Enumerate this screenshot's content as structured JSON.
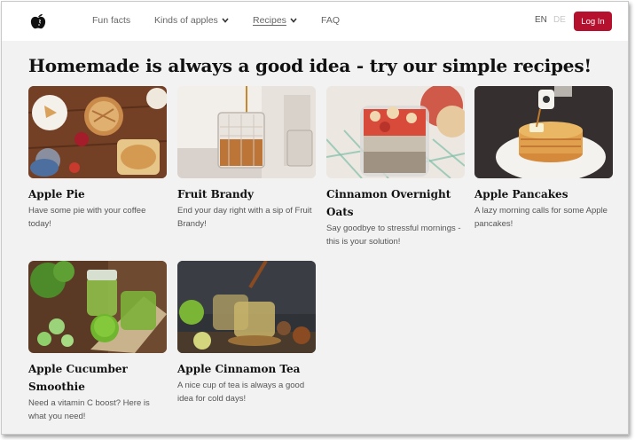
{
  "nav": {
    "links": [
      {
        "label": "Fun facts"
      },
      {
        "label": "Kinds of apples"
      },
      {
        "label": "Recipes"
      },
      {
        "label": "FAQ"
      }
    ],
    "languages": [
      "EN",
      "DE"
    ],
    "login_label": "Log In"
  },
  "heading": "Homemade is always a good idea - try our simple recipes!",
  "recipes": [
    {
      "title": "Apple Pie",
      "description": "Have some pie with your coffee today!"
    },
    {
      "title": "Fruit Brandy",
      "description": "End your day right with a sip of Fruit Brandy!"
    },
    {
      "title": "Cinnamon Overnight Oats",
      "description": "Say goodbye to stressful mornings - this is your solution!"
    },
    {
      "title": "Apple Pancakes",
      "description": "A lazy morning calls for some Apple pancakes!"
    },
    {
      "title": "Apple Cucumber Smoothie",
      "description": "Need a vitamin C boost? Here is what you need!"
    },
    {
      "title": "Apple Cinnamon Tea",
      "description": "A nice cup of tea is always a good idea for cold days!"
    }
  ],
  "colors": {
    "accent": "#b5102e",
    "background": "#f2f2f2"
  }
}
